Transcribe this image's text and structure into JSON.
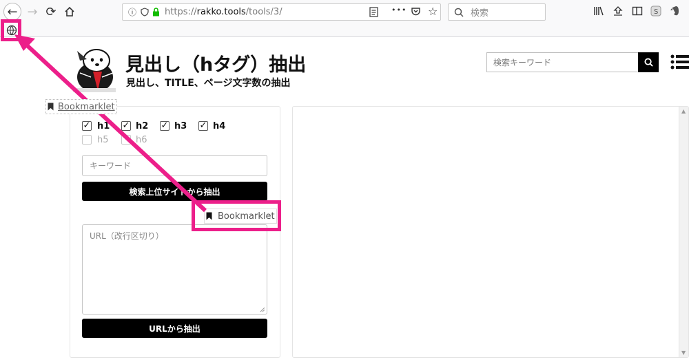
{
  "browser": {
    "url_scheme": "https://",
    "url_host": "rakko.tools",
    "url_path": "/tools/3/",
    "search_placeholder": "検索",
    "more_dots": "•••"
  },
  "header": {
    "title": "見出し（hタグ）抽出",
    "subtitle": "見出し、TITLE、ページ文字数の抽出",
    "search_placeholder": "検索キーワード"
  },
  "form": {
    "headings": [
      {
        "label": "h1",
        "checked": true
      },
      {
        "label": "h2",
        "checked": true
      },
      {
        "label": "h3",
        "checked": true
      },
      {
        "label": "h4",
        "checked": true
      },
      {
        "label": "h5",
        "checked": false
      },
      {
        "label": "h6",
        "checked": false
      }
    ],
    "keyword_placeholder": "キーワード",
    "search_button": "検索上位サイトから抽出",
    "bookmarklet_label": "Bookmarklet",
    "url_placeholder": "URL（改行区切り）",
    "url_button": "URLから抽出"
  },
  "annotation": {
    "color": "#ec1f8a",
    "dragged_label": "Bookmarklet"
  },
  "colors": {
    "accent": "#ec1f8a",
    "button": "#000000",
    "secure_lock": "#12bc00"
  }
}
